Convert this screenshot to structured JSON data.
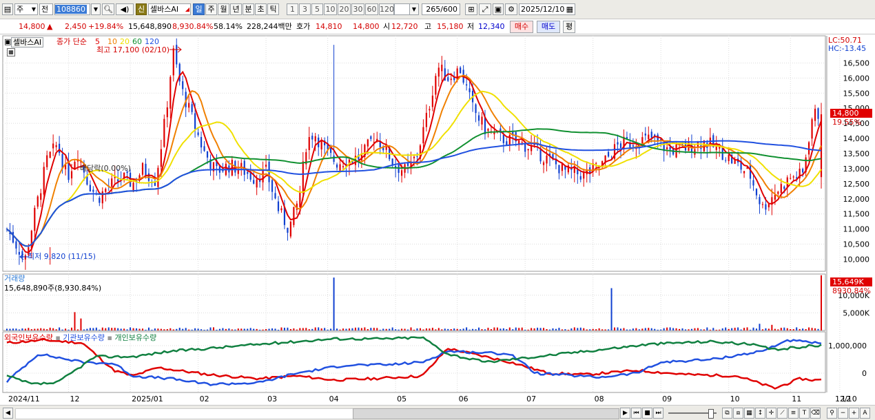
{
  "toolbar": {
    "market": "주",
    "scope": "전",
    "code": "108860",
    "stock_name": "셀바스AI",
    "badge_new": "신",
    "periods": [
      "일",
      "주",
      "월",
      "년",
      "분",
      "초",
      "틱"
    ],
    "active_period": "일",
    "intervals": [
      "1",
      "3",
      "5",
      "10",
      "20",
      "30",
      "60",
      "120"
    ],
    "count_current": "265",
    "count_max": "/600",
    "date": "2025/12/10"
  },
  "quote": {
    "price": "14,800",
    "arrow": "▲",
    "change": "2,450",
    "change_pct": "+19.84%",
    "volume": "15,648,890",
    "volume_ratio": "8,930.84%",
    "turnover": "58.14%",
    "amount": "228,244백만",
    "bid_label": "호가",
    "ask1": "14,810",
    "bid1": "14,800",
    "open_label": "시",
    "open": "12,720",
    "high_label": "고",
    "high": "15,180",
    "low_label": "저",
    "low": "12,340",
    "buy_label": "매수",
    "sell_label": "매도",
    "avg_label": "평"
  },
  "legend": {
    "name": "셀바스AI",
    "ma_title": "종가 단순",
    "ma_periods": [
      "5",
      "10",
      "20",
      "60",
      "120"
    ],
    "ma_colors": [
      "#e00000",
      "#f08000",
      "#f0e000",
      "#109030",
      "#2050e0"
    ],
    "high_annot": "최고 17,100 (02/10)",
    "low_annot": "최저 9,820 (11/15)",
    "ratio_annot": "배당락(0.00%)",
    "lc": "LC:50.71",
    "hc": "HC:-13.45",
    "price_tag": "14,800",
    "pct_tag": "19.55%"
  },
  "volume_panel": {
    "title": "거래량",
    "summary": "15,648,890주(8,930.84%)",
    "tag_value": "15,649K",
    "tag_pct": "8930.84%"
  },
  "holdings_panel": {
    "series": [
      "외국인보유수량",
      "기관보유수량",
      "개인보유수량"
    ],
    "colors": [
      "#e00000",
      "#2050e0",
      "#108040"
    ]
  },
  "colors": {
    "up": "#e00000",
    "down": "#1040d0",
    "grid": "#dcdcdc",
    "tag_bg": "#e00000"
  },
  "chart_data": {
    "type": "candlestick",
    "price_axis": {
      "ticks": [
        10000,
        10500,
        11000,
        11500,
        12000,
        12500,
        13000,
        13500,
        14000,
        14500,
        15000,
        15500,
        16000,
        16500
      ],
      "range": [
        9600,
        17400
      ]
    },
    "volume_axis": {
      "ticks": [
        5000,
        10000
      ],
      "unit": "K"
    },
    "holdings_axis": {
      "ticks": [
        0,
        1000000
      ]
    },
    "x_labels": [
      "2024/11",
      "12",
      "2025/01",
      "02",
      "03",
      "04",
      "05",
      "06",
      "07",
      "08",
      "09",
      "10",
      "11",
      "12",
      "12/10"
    ],
    "anchors": [
      [
        0,
        11000
      ],
      [
        10,
        10300
      ],
      [
        14,
        9900
      ],
      [
        22,
        11500
      ],
      [
        32,
        13300
      ],
      [
        40,
        13800
      ],
      [
        48,
        12700
      ],
      [
        56,
        13600
      ],
      [
        64,
        12600
      ],
      [
        72,
        12000
      ],
      [
        80,
        12400
      ],
      [
        92,
        12700
      ],
      [
        100,
        12500
      ],
      [
        108,
        13000
      ],
      [
        118,
        12600
      ],
      [
        126,
        14700
      ],
      [
        132,
        16900
      ],
      [
        138,
        15700
      ],
      [
        146,
        14800
      ],
      [
        156,
        13600
      ],
      [
        166,
        12900
      ],
      [
        176,
        13100
      ],
      [
        186,
        13000
      ],
      [
        196,
        12700
      ],
      [
        206,
        12900
      ],
      [
        216,
        11600
      ],
      [
        224,
        11000
      ],
      [
        232,
        12000
      ],
      [
        238,
        13900
      ],
      [
        244,
        14200
      ],
      [
        254,
        13500
      ],
      [
        262,
        13200
      ],
      [
        272,
        13300
      ],
      [
        282,
        13400
      ],
      [
        292,
        14100
      ],
      [
        300,
        13700
      ],
      [
        308,
        13100
      ],
      [
        318,
        12900
      ],
      [
        326,
        13500
      ],
      [
        334,
        14800
      ],
      [
        342,
        16400
      ],
      [
        350,
        16000
      ],
      [
        360,
        16300
      ],
      [
        370,
        15000
      ],
      [
        380,
        14300
      ],
      [
        392,
        14000
      ],
      [
        404,
        13900
      ],
      [
        416,
        13700
      ],
      [
        430,
        13300
      ],
      [
        444,
        12900
      ],
      [
        458,
        12800
      ],
      [
        472,
        13100
      ],
      [
        486,
        13800
      ],
      [
        500,
        13900
      ],
      [
        512,
        14000
      ],
      [
        526,
        13600
      ],
      [
        540,
        13700
      ],
      [
        554,
        13900
      ],
      [
        566,
        13600
      ],
      [
        578,
        13200
      ],
      [
        590,
        12800
      ],
      [
        600,
        11700
      ],
      [
        610,
        12200
      ],
      [
        622,
        12700
      ],
      [
        632,
        12800
      ],
      [
        640,
        14800
      ]
    ],
    "holdings": {
      "foreign": [
        [
          0,
          1100000
        ],
        [
          30,
          1200000
        ],
        [
          60,
          1100000
        ],
        [
          85,
          100000
        ],
        [
          100,
          -100000
        ],
        [
          120,
          200000
        ],
        [
          160,
          -50000
        ],
        [
          200,
          -200000
        ],
        [
          230,
          -100000
        ],
        [
          260,
          -250000
        ],
        [
          290,
          -200000
        ],
        [
          330,
          -100000
        ],
        [
          350,
          900000
        ],
        [
          380,
          600000
        ],
        [
          400,
          400000
        ],
        [
          430,
          0
        ],
        [
          460,
          -50000
        ],
        [
          500,
          100000
        ],
        [
          540,
          -50000
        ],
        [
          580,
          -100000
        ],
        [
          610,
          -550000
        ],
        [
          630,
          -200000
        ],
        [
          640,
          -250000
        ]
      ],
      "institution": [
        [
          0,
          -300000
        ],
        [
          25,
          700000
        ],
        [
          60,
          400000
        ],
        [
          85,
          350000
        ],
        [
          100,
          -100000
        ],
        [
          130,
          -200000
        ],
        [
          160,
          -400000
        ],
        [
          200,
          -350000
        ],
        [
          230,
          0
        ],
        [
          270,
          300000
        ],
        [
          300,
          300000
        ],
        [
          330,
          400000
        ],
        [
          350,
          800000
        ],
        [
          400,
          700000
        ],
        [
          420,
          0
        ],
        [
          470,
          -150000
        ],
        [
          500,
          0
        ],
        [
          520,
          400000
        ],
        [
          560,
          500000
        ],
        [
          600,
          800000
        ],
        [
          620,
          1200000
        ],
        [
          640,
          1100000
        ]
      ],
      "individual": [
        [
          0,
          -100000
        ],
        [
          20,
          -400000
        ],
        [
          40,
          -350000
        ],
        [
          70,
          600000
        ],
        [
          100,
          600000
        ],
        [
          130,
          800000
        ],
        [
          160,
          900000
        ],
        [
          200,
          1050000
        ],
        [
          230,
          1150000
        ],
        [
          260,
          1250000
        ],
        [
          300,
          1250000
        ],
        [
          330,
          1300000
        ],
        [
          350,
          700000
        ],
        [
          380,
          400000
        ],
        [
          420,
          600000
        ],
        [
          450,
          750000
        ],
        [
          480,
          900000
        ],
        [
          510,
          1050000
        ],
        [
          530,
          1100000
        ],
        [
          560,
          1150000
        ],
        [
          590,
          1050000
        ],
        [
          610,
          850000
        ],
        [
          640,
          1000000
        ]
      ]
    }
  }
}
